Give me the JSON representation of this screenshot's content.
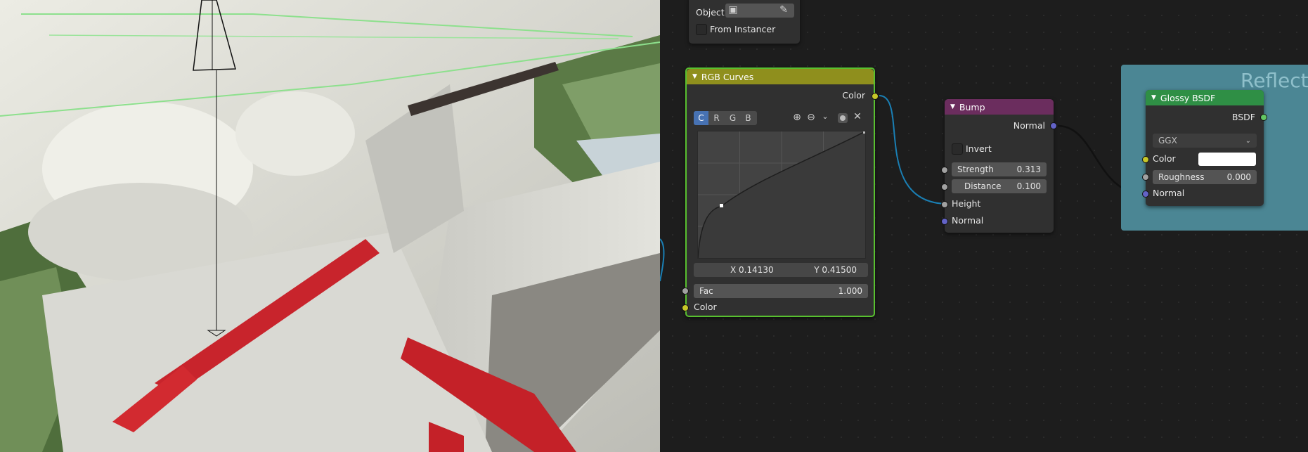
{
  "object_panel": {
    "object_label": "Object:",
    "from_instancer_label": "From Instancer"
  },
  "rgb_curves": {
    "title": "RGB Curves",
    "output_color": "Color",
    "channels": [
      "C",
      "R",
      "G",
      "B"
    ],
    "active_channel": "C",
    "x_readout": "X 0.14130",
    "y_readout": "Y 0.41500",
    "fac_label": "Fac",
    "fac_value": "1.000",
    "input_color": "Color",
    "header_color": "#8f8f1d",
    "frame_color": "#58c02f"
  },
  "bump": {
    "title": "Bump",
    "output_normal": "Normal",
    "invert_label": "Invert",
    "strength_label": "Strength",
    "strength_value": "0.313",
    "distance_label": "Distance",
    "distance_value": "0.100",
    "height_label": "Height",
    "normal_label": "Normal",
    "header_color": "#6b2d5e"
  },
  "frame": {
    "label": "Reflect",
    "color": "#4b8694"
  },
  "glossy": {
    "title": "Glossy BSDF",
    "output_bsdf": "BSDF",
    "distribution": "GGX",
    "color_label": "Color",
    "color_swatch": "#ffffff",
    "roughness_label": "Roughness",
    "roughness_value": "0.000",
    "normal_label": "Normal",
    "header_color": "#2f8f45"
  },
  "socket_colors": {
    "color": "#c7c729",
    "float": "#a1a1a1",
    "vector": "#6363c7",
    "shader": "#63c763"
  },
  "icons": [
    "object-icon",
    "eyedropper-icon",
    "zoom-in-icon",
    "zoom-out-icon",
    "dropdown-chevron-icon",
    "curve-tool-icon",
    "close-icon"
  ]
}
